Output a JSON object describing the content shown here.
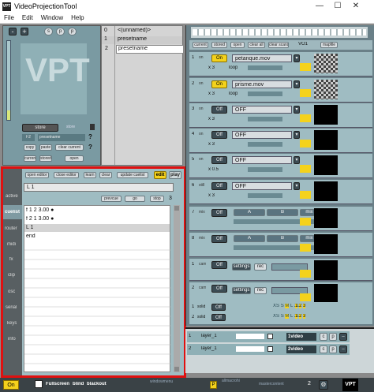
{
  "window": {
    "title": "VideoProjectionTool",
    "minimize": "—",
    "maximize": "☐",
    "close": "✕"
  },
  "menu": [
    "File",
    "Edit",
    "Window",
    "Help"
  ],
  "preset": {
    "minus": "-",
    "plus": "+",
    "s": "s",
    "c": "p",
    "p": "p",
    "logo": "VPT",
    "store": "store",
    "store_btn": "store",
    "store2": "store",
    "num": "f-2",
    "name": "presetname",
    "btns": [
      "copy",
      "paste",
      "clear current"
    ],
    "btns2": [
      "current",
      "stored",
      "open"
    ],
    "qmark1": "?",
    "qmark2": "?",
    "rows": [
      {
        "n": "0",
        "name": "<(unnamed)>"
      },
      {
        "n": "1",
        "name": "presetname"
      },
      {
        "n": "2",
        "name": "presetname"
      }
    ]
  },
  "cuelist": {
    "top_btns": [
      "open editor",
      "close editor",
      "learn",
      "clear"
    ],
    "update": "update cuelist",
    "edit": "edit",
    "play": "play",
    "input": "L 1",
    "ctrl_btns": [
      "prevcue",
      "go",
      "stop"
    ],
    "count": "3",
    "lines": [
      "f 1 2 3.00 ●",
      "f 2 1 3.00 ●",
      "L 1",
      "end"
    ],
    "tabs": [
      "active",
      "cuelist",
      "router",
      "midi",
      "fx",
      "clip",
      "osc",
      "serial",
      "keys",
      "info"
    ]
  },
  "layers": {
    "toolbar": [
      "current",
      "stored",
      "open",
      "clear all",
      "clear scans",
      "VO1",
      "mapfile"
    ],
    "rows": [
      {
        "n": "1",
        "mode": "on",
        "state": "On",
        "file": "petanque.mov",
        "x": "3",
        "opt": "loop",
        "has_thumb": true
      },
      {
        "n": "2",
        "mode": "on",
        "state": "On",
        "file": "prisme.mov",
        "x": "3",
        "opt": "loop",
        "has_thumb": true
      },
      {
        "n": "3",
        "mode": "on",
        "state": "Off",
        "file": "OFF",
        "x": "3",
        "opt": "",
        "has_thumb": false
      },
      {
        "n": "4",
        "mode": "on",
        "state": "Off",
        "file": "OFF",
        "x": "3",
        "opt": "",
        "has_thumb": false
      },
      {
        "n": "5",
        "mode": "on",
        "state": "Off",
        "file": "OFF",
        "x": "0.5",
        "opt": "",
        "has_thumb": false
      },
      {
        "n": "6",
        "mode": "still",
        "state": "Off",
        "file": "OFF",
        "x": "3",
        "opt": "",
        "has_thumb": false
      },
      {
        "n": "7",
        "mode": "mix",
        "state": "Off",
        "file": "A",
        "b": "B",
        "c": "mix",
        "has_thumb": false
      },
      {
        "n": "8",
        "mode": "mix",
        "state": "Off",
        "file": "A",
        "b": "B",
        "c": "mix",
        "has_thumb": false
      },
      {
        "n": "1",
        "mode": "cam",
        "state": "Off",
        "file": "settings",
        "rec": "rec",
        "has_thumb": false
      },
      {
        "n": "2",
        "mode": "cam",
        "state": "Off",
        "file": "settings",
        "rec": "rec",
        "has_thumb": false
      }
    ],
    "solid": [
      {
        "n": "1",
        "state": "Off",
        "sizes": [
          "XS",
          "S",
          "M",
          "L",
          "XL"
        ],
        "nums": [
          "1",
          "2",
          "3"
        ]
      },
      {
        "n": "2",
        "state": "Off",
        "sizes": [
          "XS",
          "S",
          "M",
          "L",
          "XL"
        ],
        "nums": [
          "1",
          "2",
          "3"
        ]
      }
    ]
  },
  "outputs": [
    {
      "n": "1",
      "name": "layer_1",
      "label": "1video",
      "c": "c",
      "p": "p"
    },
    {
      "n": "2",
      "name": "layer_1",
      "label": "2video",
      "c": "c",
      "p": "p"
    }
  ],
  "bottom": {
    "on": "On",
    "fullscreen": "Fullscreen",
    "blind": "blind",
    "blackout": "blackout",
    "windowmenu": "windowmenu",
    "p": "P",
    "allmacrohi": "allmacrohi",
    "mastercontent": "mastercontent",
    "n": "2",
    "logo": "VPT"
  }
}
